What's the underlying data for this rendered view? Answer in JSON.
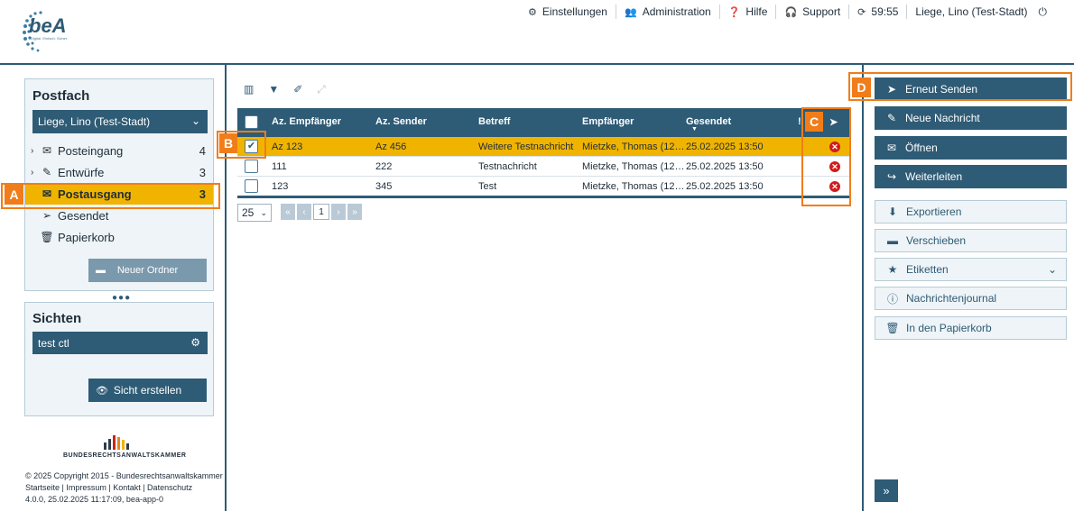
{
  "logo": {
    "name": "beA",
    "tagline": "Digital. Einfach. Sicher."
  },
  "topnav": [
    {
      "icon": "gear-icon",
      "label": "Einstellungen"
    },
    {
      "icon": "users-icon",
      "label": "Administration"
    },
    {
      "icon": "help-icon",
      "label": "Hilfe"
    },
    {
      "icon": "headset-icon",
      "label": "Support"
    },
    {
      "icon": "refresh-icon",
      "label": "59:55"
    },
    {
      "icon": "",
      "label": "Liege, Lino (Test-Stadt)"
    },
    {
      "icon": "power-icon",
      "label": "⏻"
    }
  ],
  "postfach": {
    "title": "Postfach",
    "account": "Liege, Lino (Test-Stadt)",
    "folders": [
      {
        "label": "Posteingang",
        "count": "4",
        "icon": "inbox-icon",
        "expand": true
      },
      {
        "label": "Entwürfe",
        "count": "3",
        "icon": "draft-icon",
        "expand": true
      },
      {
        "label": "Postausgang",
        "count": "3",
        "icon": "outbox-icon",
        "expand": false
      },
      {
        "label": "Gesendet",
        "count": "",
        "icon": "sent-icon",
        "expand": false
      },
      {
        "label": "Papierkorb",
        "count": "",
        "icon": "trash-icon",
        "expand": false
      }
    ],
    "new_folder": "Neuer Ordner"
  },
  "sichten": {
    "title": "Sichten",
    "item": "test ctl",
    "create": "Sicht erstellen"
  },
  "brak": {
    "name": "BUNDESRECHTSANWALTSKAMMER"
  },
  "footer": {
    "copyright": "© 2025 Copyright 2015 - Bundesrechtsanwaltskammer",
    "links": "Startseite | Impressum | Kontakt | Datenschutz",
    "version": "4.0.0, 25.02.2025 11:17:09, bea-app-0"
  },
  "table": {
    "headers": [
      "Az. Empfänger",
      "Az. Sender",
      "Betreff",
      "Empfänger",
      "Gesendet"
    ],
    "rows": [
      {
        "az_empf": "Az 123",
        "az_send": "Az 456",
        "betreff": "Weitere Testnachricht",
        "empf": "Mietzke, Thomas (12…",
        "gesendet": "25.02.2025 13:50",
        "checked": true
      },
      {
        "az_empf": "111",
        "az_send": "222",
        "betreff": "Testnachricht",
        "empf": "Mietzke, Thomas (12…",
        "gesendet": "25.02.2025 13:50",
        "checked": false
      },
      {
        "az_empf": "123",
        "az_send": "345",
        "betreff": "Test",
        "empf": "Mietzke, Thomas (12…",
        "gesendet": "25.02.2025 13:50",
        "checked": false
      }
    ],
    "page_size": "25",
    "page": "1"
  },
  "actions": [
    {
      "label": "Erneut Senden",
      "icon": "send-icon",
      "style": "dark"
    },
    {
      "label": "Neue Nachricht",
      "icon": "pencil-icon",
      "style": "dark"
    },
    {
      "label": "Öffnen",
      "icon": "envelope-icon",
      "style": "dark"
    },
    {
      "label": "Weiterleiten",
      "icon": "forward-icon",
      "style": "dark"
    },
    {
      "label": "Exportieren",
      "icon": "download-icon",
      "style": "light"
    },
    {
      "label": "Verschieben",
      "icon": "folder-open-icon",
      "style": "light"
    },
    {
      "label": "Etiketten",
      "icon": "tag-icon",
      "style": "light"
    },
    {
      "label": "Nachrichtenjournal",
      "icon": "info-icon",
      "style": "light"
    },
    {
      "label": "In den Papierkorb",
      "icon": "trash-icon",
      "style": "light"
    }
  ],
  "markers": {
    "a": "A",
    "b": "B",
    "c": "C",
    "d": "D"
  },
  "colors": {
    "primary": "#2e5b75",
    "highlight": "#f0b400",
    "marker": "#f07d1a",
    "error": "#d01c1c"
  }
}
